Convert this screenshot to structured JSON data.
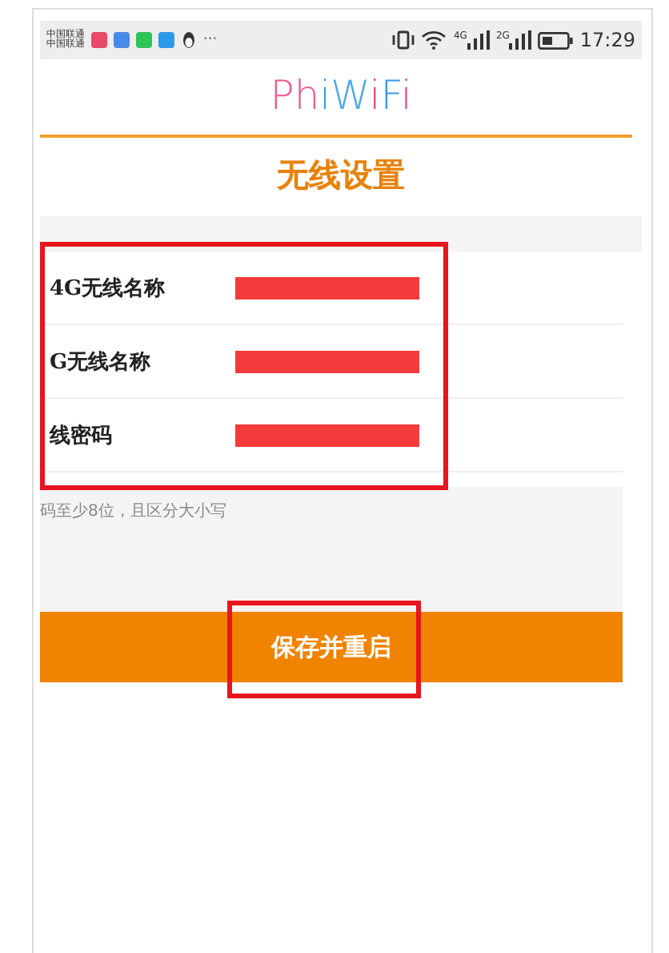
{
  "status_bar": {
    "carriers": [
      "中国联通",
      "中国联通"
    ],
    "more": "···",
    "time": "17:29",
    "network_1": "4G",
    "network_2": "2G"
  },
  "logo": "PhiWiFi",
  "title": "无线设置",
  "fields": [
    {
      "label": "4G无线名称",
      "redacted": true
    },
    {
      "label": "G无线名称",
      "redacted": true
    },
    {
      "label": "线密码",
      "redacted": true
    }
  ],
  "hint": "码至少8位，且区分大小写",
  "save_button": "保存并重启"
}
